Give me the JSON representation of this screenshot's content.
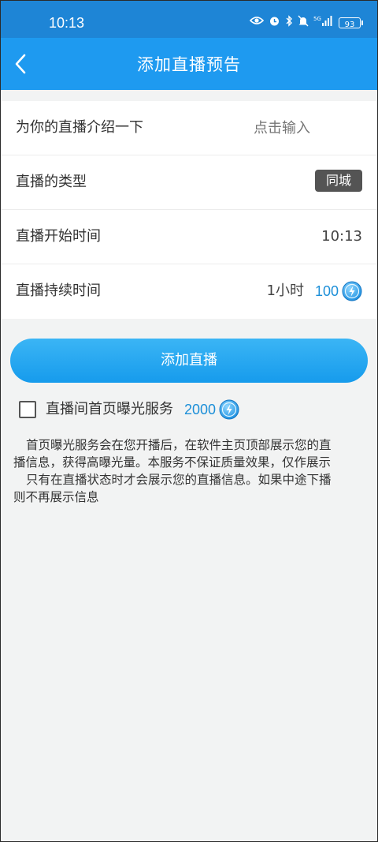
{
  "status_bar": {
    "time": "10:13",
    "icons": [
      "eye-icon",
      "alarm-icon",
      "bluetooth-icon",
      "mute-icon",
      "5g-signal-icon",
      "battery-icon"
    ],
    "network": "5G",
    "battery": "93"
  },
  "header": {
    "title": "添加直播预告",
    "back_icon": "chevron-left-icon"
  },
  "form": {
    "intro": {
      "label": "为你的直播介绍一下",
      "placeholder": "点击输入"
    },
    "type": {
      "label": "直播的类型",
      "value": "同城"
    },
    "start_time": {
      "label": "直播开始时间",
      "value": "10:13"
    },
    "duration": {
      "label": "直播持续时间",
      "value": "1小时",
      "cost": "100",
      "cost_icon": "lightning-coin-icon"
    }
  },
  "add_button": {
    "label": "添加直播"
  },
  "exposure": {
    "label": "直播间首页曝光服务",
    "cost": "2000",
    "checked": false
  },
  "description": {
    "lines": [
      "首页曝光服务会在您开播后，在软件主页顶部展示您的直",
      "播信息，获得高曝光量。本服务不保证质量效果，仅作展示",
      "只有在直播状态时才会展示您的直播信息。如果中途下播",
      "则不再展示信息"
    ]
  },
  "colors": {
    "status_bar": "#1e85d6",
    "header": "#1e9af0",
    "accent": "#1c8fd8",
    "tag_bg": "#545454",
    "page_bg": "#f2f3f3"
  }
}
